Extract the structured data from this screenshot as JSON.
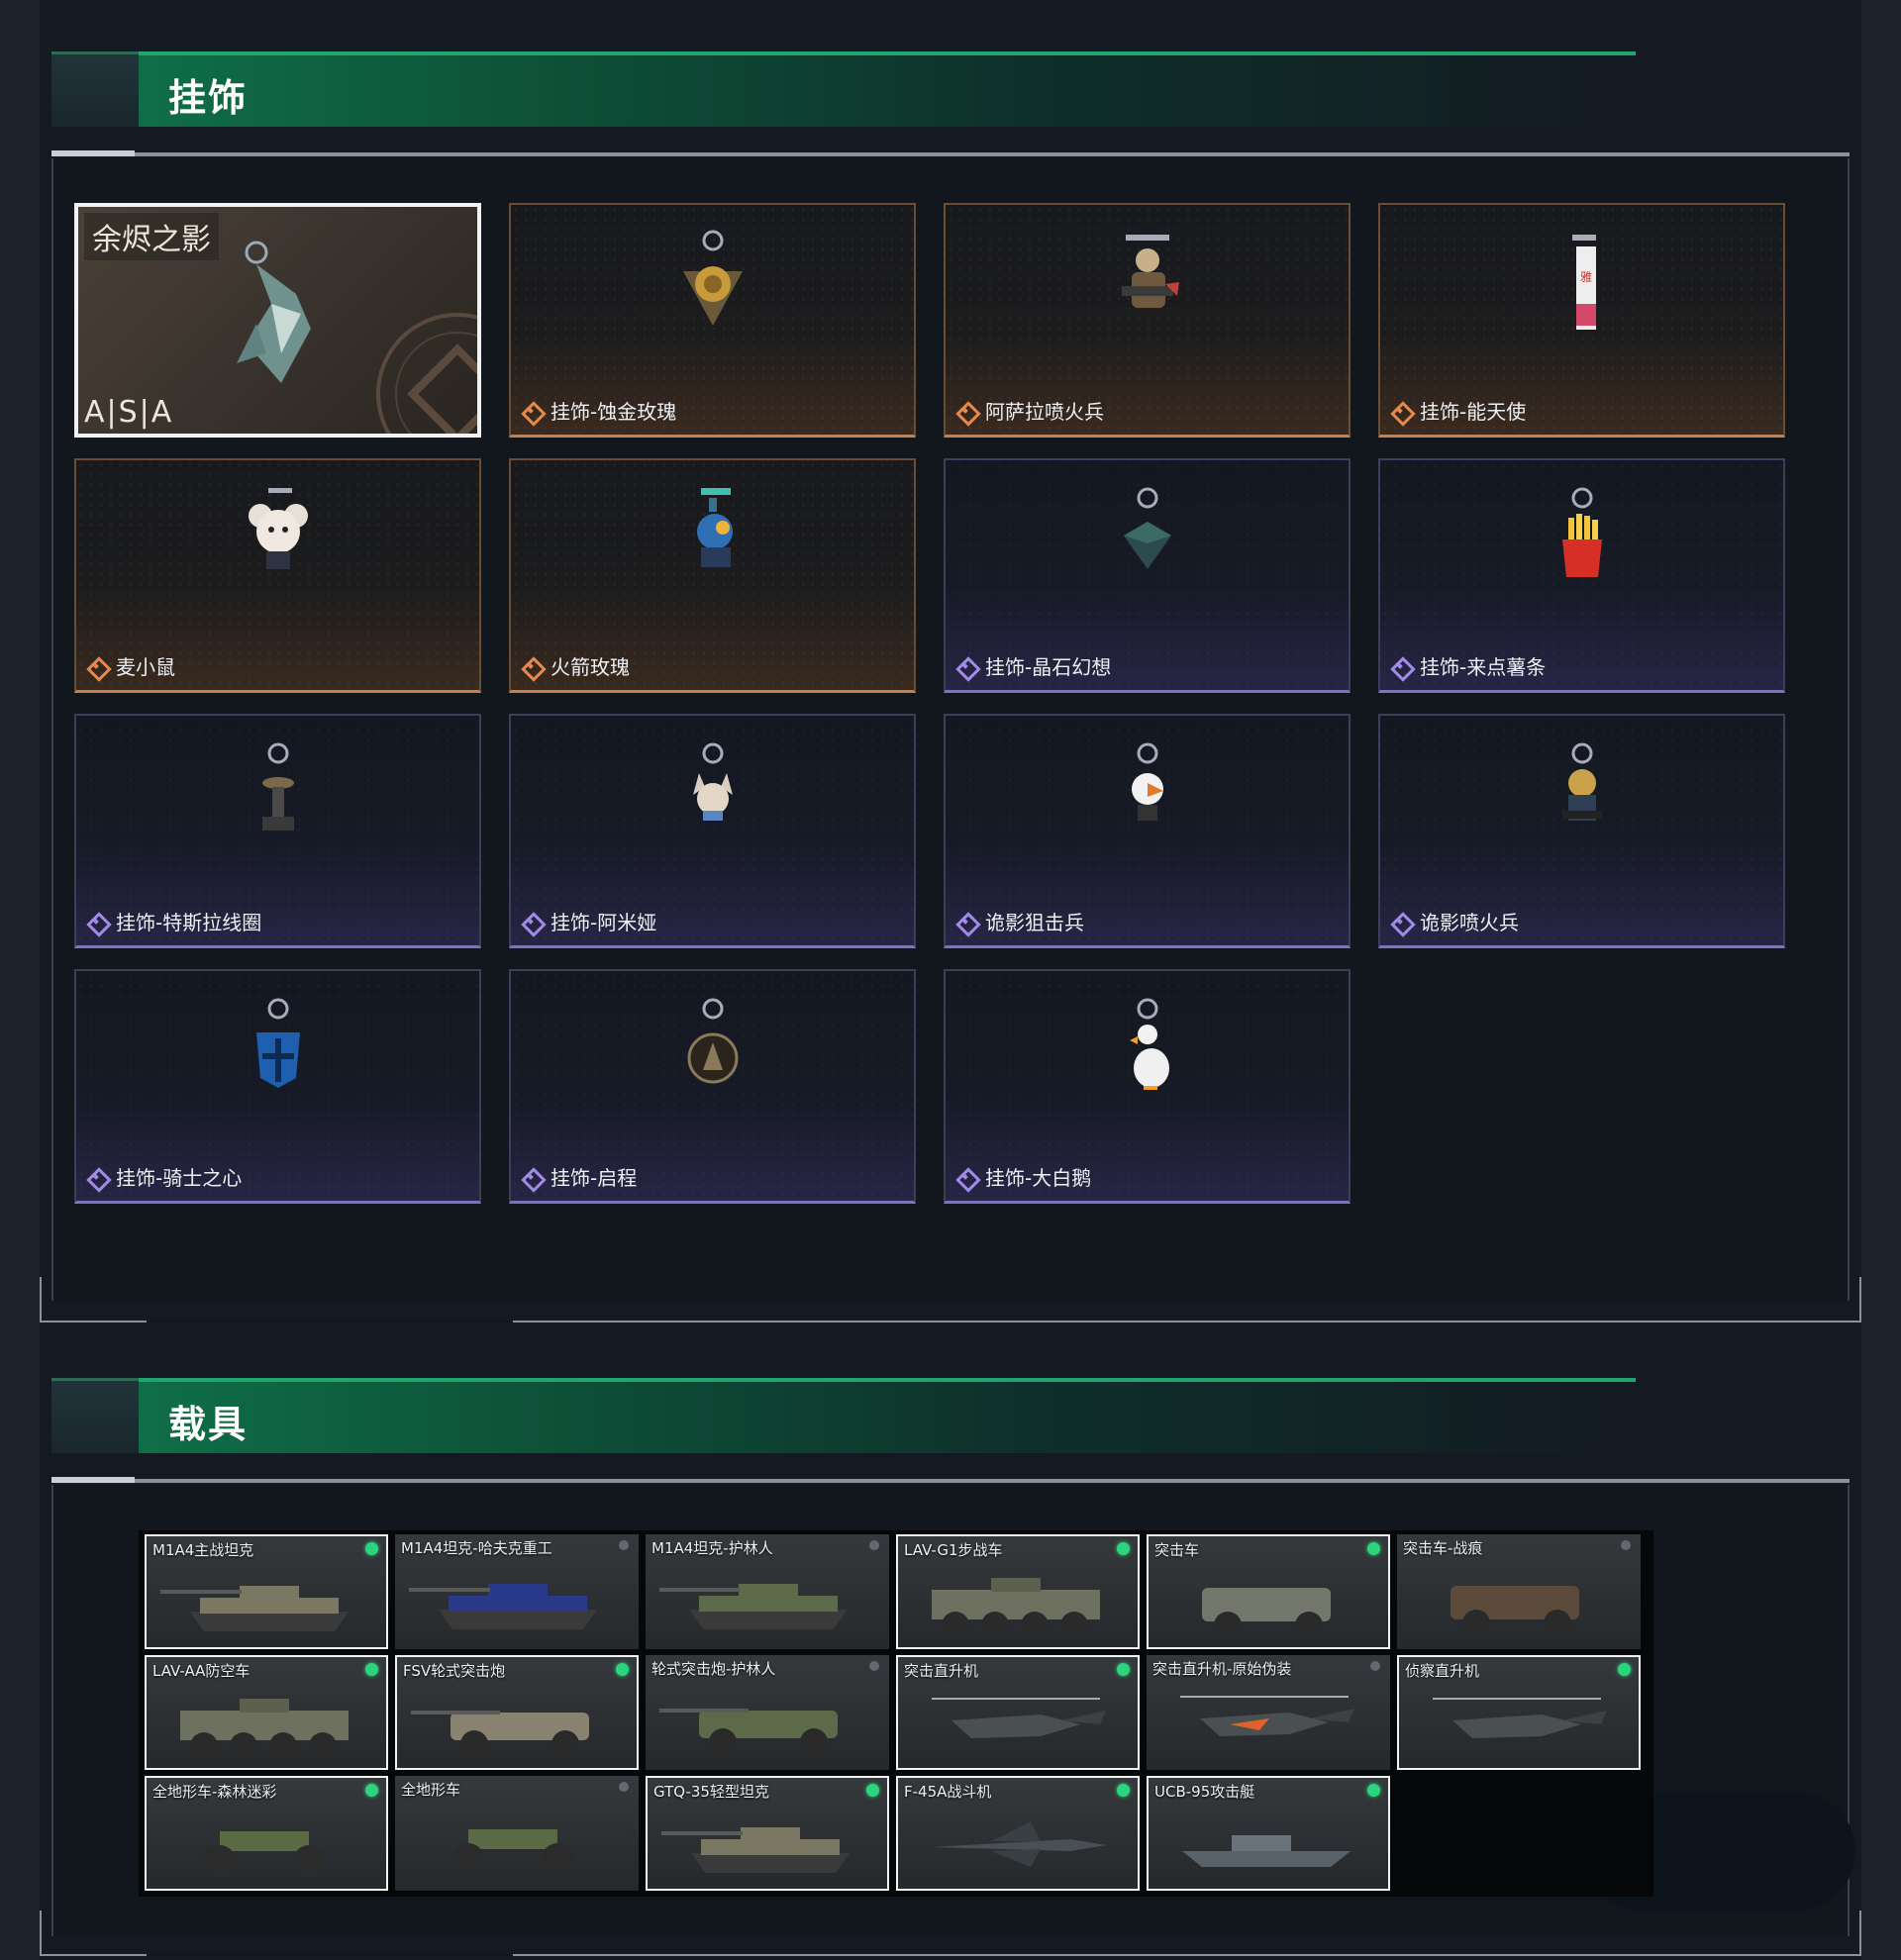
{
  "sections": {
    "charms": {
      "title": "挂饰"
    },
    "vehicles": {
      "title": "载具"
    }
  },
  "featured": {
    "title": "余烬之影",
    "brand": "A|S|A"
  },
  "charms": [
    {
      "name": "挂饰-蚀金玫瑰",
      "rarity": "gold",
      "icon": "gold-rose-charm-icon"
    },
    {
      "name": "阿萨拉喷火兵",
      "rarity": "gold",
      "icon": "flamethrower-soldier-charm-icon"
    },
    {
      "name": "挂饰-能天使",
      "rarity": "gold",
      "icon": "exusiai-tag-charm-icon"
    },
    {
      "name": "麦小鼠",
      "rarity": "gold",
      "icon": "mouse-charm-icon"
    },
    {
      "name": "火箭玫瑰",
      "rarity": "gold",
      "icon": "rocket-rose-charm-icon"
    },
    {
      "name": "挂饰-晶石幻想",
      "rarity": "purple",
      "icon": "crystal-cube-charm-icon"
    },
    {
      "name": "挂饰-来点薯条",
      "rarity": "purple",
      "icon": "fries-charm-icon"
    },
    {
      "name": "挂饰-特斯拉线圈",
      "rarity": "purple",
      "icon": "tesla-coil-charm-icon"
    },
    {
      "name": "挂饰-阿米娅",
      "rarity": "purple",
      "icon": "amiya-charm-icon"
    },
    {
      "name": "诡影狙击兵",
      "rarity": "purple",
      "icon": "sniper-charm-icon"
    },
    {
      "name": "诡影喷火兵",
      "rarity": "purple",
      "icon": "shadow-flamethrower-charm-icon"
    },
    {
      "name": "挂饰-骑士之心",
      "rarity": "purple",
      "icon": "knight-heart-charm-icon"
    },
    {
      "name": "挂饰-启程",
      "rarity": "purple",
      "icon": "departure-coin-charm-icon"
    },
    {
      "name": "挂饰-大白鹅",
      "rarity": "purple",
      "icon": "goose-charm-icon"
    }
  ],
  "vehicles": [
    {
      "name": "M1A4主战坦克",
      "owned": true,
      "equipped": true,
      "icon": "tank-icon"
    },
    {
      "name": "M1A4坦克-哈夫克重工",
      "owned": false,
      "equipped": false,
      "icon": "tank-haavk-icon"
    },
    {
      "name": "M1A4坦克-护林人",
      "owned": false,
      "equipped": false,
      "icon": "tank-forest-icon"
    },
    {
      "name": "LAV-G1步战车",
      "owned": true,
      "equipped": true,
      "icon": "ifv-icon"
    },
    {
      "name": "突击车",
      "owned": true,
      "equipped": true,
      "icon": "assault-car-icon"
    },
    {
      "name": "突击车-战痕",
      "owned": false,
      "equipped": false,
      "icon": "assault-car-scar-icon"
    },
    {
      "name": "LAV-AA防空车",
      "owned": true,
      "equipped": true,
      "icon": "aa-vehicle-icon"
    },
    {
      "name": "FSV轮式突击炮",
      "owned": true,
      "equipped": true,
      "icon": "wheeled-gun-icon"
    },
    {
      "name": "轮式突击炮-护林人",
      "owned": false,
      "equipped": false,
      "icon": "wheeled-gun-forest-icon"
    },
    {
      "name": "突击直升机",
      "owned": true,
      "equipped": true,
      "icon": "attack-helicopter-icon"
    },
    {
      "name": "突击直升机-原始伪装",
      "owned": false,
      "equipped": false,
      "icon": "attack-helicopter-camo-icon"
    },
    {
      "name": "侦察直升机",
      "owned": true,
      "equipped": true,
      "icon": "scout-helicopter-icon"
    },
    {
      "name": "全地形车-森林迷彩",
      "owned": true,
      "equipped": true,
      "icon": "atv-camo-icon"
    },
    {
      "name": "全地形车",
      "owned": false,
      "equipped": false,
      "icon": "atv-icon"
    },
    {
      "name": "GTQ-35轻型坦克",
      "owned": true,
      "equipped": true,
      "icon": "light-tank-icon"
    },
    {
      "name": "F-45A战斗机",
      "owned": true,
      "equipped": true,
      "icon": "fighter-jet-icon"
    },
    {
      "name": "UCB-95攻击艇",
      "owned": true,
      "equipped": true,
      "icon": "attack-boat-icon"
    }
  ]
}
